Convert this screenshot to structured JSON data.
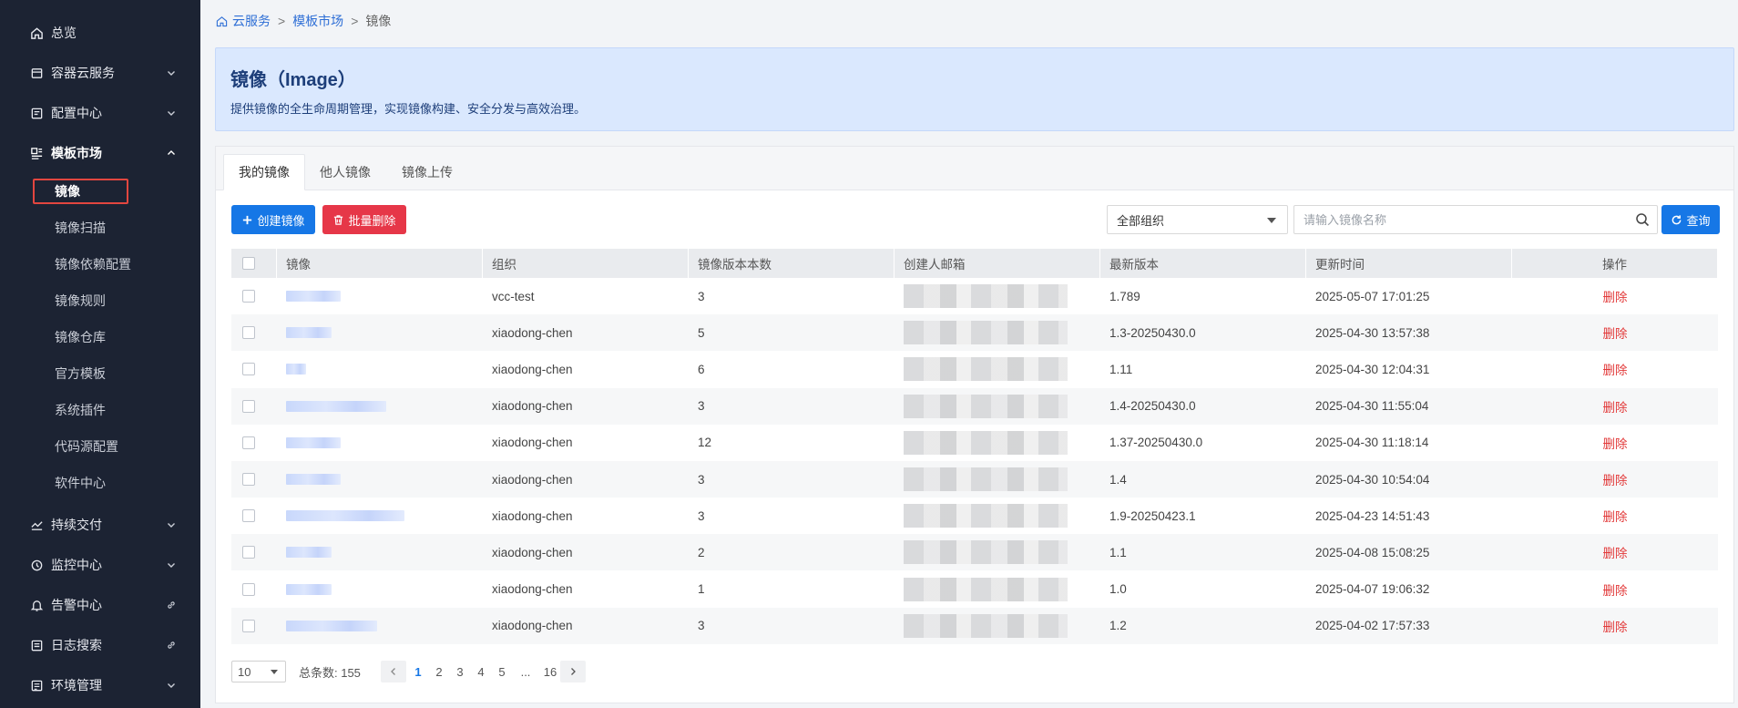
{
  "sidebar": {
    "items": [
      {
        "label": "总览"
      },
      {
        "label": "容器云服务"
      },
      {
        "label": "配置中心"
      },
      {
        "label": "模板市场"
      },
      {
        "label": "持续交付"
      },
      {
        "label": "监控中心"
      },
      {
        "label": "告警中心"
      },
      {
        "label": "日志搜索"
      },
      {
        "label": "环境管理"
      }
    ],
    "sub_items": [
      "镜像",
      "镜像扫描",
      "镜像依赖配置",
      "镜像规则",
      "镜像仓库",
      "官方模板",
      "系统插件",
      "代码源配置",
      "软件中心"
    ]
  },
  "breadcrumb": {
    "home": "云服务",
    "section": "模板市场",
    "current": "镜像",
    "separator": ">"
  },
  "banner": {
    "title": "镜像（Image）",
    "description": "提供镜像的全生命周期管理，实现镜像构建、安全分发与高效治理。"
  },
  "tabs": [
    "我的镜像",
    "他人镜像",
    "镜像上传"
  ],
  "toolbar": {
    "create_label": "创建镜像",
    "batch_delete_label": "批量删除",
    "org_select_value": "全部组织",
    "search_placeholder": "请输入镜像名称",
    "query_label": "查询"
  },
  "table": {
    "headers": [
      "镜像",
      "组织",
      "镜像版本本数",
      "创建人邮箱",
      "最新版本",
      "更新时间",
      "操作"
    ],
    "rows": [
      {
        "org": "vcc-test",
        "versions": "3",
        "latest": "1.789",
        "updated": "2025-05-07 17:01:25",
        "action": "删除"
      },
      {
        "org": "xiaodong-chen",
        "versions": "5",
        "latest": "1.3-20250430.0",
        "updated": "2025-04-30 13:57:38",
        "action": "删除"
      },
      {
        "org": "xiaodong-chen",
        "versions": "6",
        "latest": "1.11",
        "updated": "2025-04-30 12:04:31",
        "action": "删除"
      },
      {
        "org": "xiaodong-chen",
        "versions": "3",
        "latest": "1.4-20250430.0",
        "updated": "2025-04-30 11:55:04",
        "action": "删除"
      },
      {
        "org": "xiaodong-chen",
        "versions": "12",
        "latest": "1.37-20250430.0",
        "updated": "2025-04-30 11:18:14",
        "action": "删除"
      },
      {
        "org": "xiaodong-chen",
        "versions": "3",
        "latest": "1.4",
        "updated": "2025-04-30 10:54:04",
        "action": "删除"
      },
      {
        "org": "xiaodong-chen",
        "versions": "3",
        "latest": "1.9-20250423.1",
        "updated": "2025-04-23 14:51:43",
        "action": "删除"
      },
      {
        "org": "xiaodong-chen",
        "versions": "2",
        "latest": "1.1",
        "updated": "2025-04-08 15:08:25",
        "action": "删除"
      },
      {
        "org": "xiaodong-chen",
        "versions": "1",
        "latest": "1.0",
        "updated": "2025-04-07 19:06:32",
        "action": "删除"
      },
      {
        "org": "xiaodong-chen",
        "versions": "3",
        "latest": "1.2",
        "updated": "2025-04-02 17:57:33",
        "action": "删除"
      }
    ]
  },
  "pagination": {
    "page_size": "10",
    "total_text": "总条数: 155",
    "pages": [
      "1",
      "2",
      "3",
      "4",
      "5",
      "...",
      "16"
    ],
    "current": "1"
  },
  "colors": {
    "sidebar_bg": "#1c2333",
    "primary": "#1677e6",
    "danger": "#e63748",
    "banner_bg": "#dae8fe"
  }
}
